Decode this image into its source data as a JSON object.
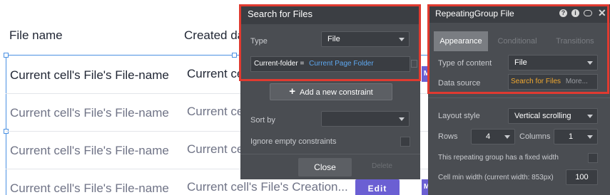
{
  "table": {
    "headers": {
      "file_name": "File name",
      "created_date": "Created da"
    },
    "rows": [
      {
        "file": "Current cell's File's File-name",
        "created": "Current ce"
      },
      {
        "file": "Current cell's File's File-name",
        "created": "Current ce"
      },
      {
        "file": "Current cell's File's File-name",
        "created": "Current ce"
      },
      {
        "file": "Current cell's File's File-name",
        "created": "Current cell's File's Creation..."
      }
    ],
    "edit_label": "Edit",
    "m_label": "M"
  },
  "search_panel": {
    "title": "Search for Files",
    "type_label": "Type",
    "type_value": "File",
    "constraint_field": "Current-folder =",
    "constraint_value": "Current Page Folder",
    "add_constraint_label": "Add a new constraint",
    "sort_by_label": "Sort by",
    "ignore_label": "Ignore empty constraints",
    "close_label": "Close",
    "delete_label": "Delete"
  },
  "rg_panel": {
    "title": "RepeatingGroup File",
    "tabs": [
      "Appearance",
      "Conditional",
      "Transitions"
    ],
    "type_of_content_label": "Type of content",
    "type_of_content_value": "File",
    "data_source_label": "Data source",
    "data_source_value": "Search for Files",
    "data_source_more": "More...",
    "layout_style_label": "Layout style",
    "layout_style_value": "Vertical scrolling",
    "rows_label": "Rows",
    "rows_value": "4",
    "columns_label": "Columns",
    "columns_value": "1",
    "fixed_width_label": "This repeating group has a fixed width",
    "cell_min_width_label": "Cell min width (current width: 853px)",
    "cell_min_width_value": "100"
  },
  "colors": {
    "highlight": "#e03a30",
    "accent_button": "#6b5fd3",
    "link": "#5ea8f0",
    "data_source": "#f0a830",
    "panel_bg": "#4a4d52"
  }
}
